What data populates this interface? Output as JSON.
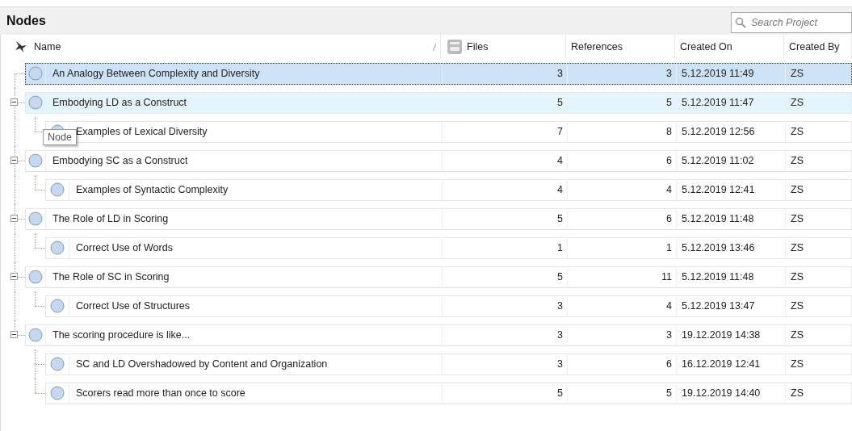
{
  "panel": {
    "title": "Nodes",
    "search": {
      "placeholder": "Search Project"
    }
  },
  "table": {
    "columns": [
      {
        "label": "Name",
        "sorted": true
      },
      {
        "label": "Files"
      },
      {
        "label": "References"
      },
      {
        "label": "Created On"
      },
      {
        "label": "Created By"
      }
    ],
    "rows": [
      {
        "name": "An Analogy Between Complexity and Diversity",
        "files": "3",
        "references": "3",
        "created_on": "5.12.2019 11:49",
        "created_by": "ZS",
        "selected": true,
        "hovered": false
      },
      {
        "name": "Embodying LD as a Construct",
        "files": "5",
        "references": "5",
        "created_on": "5.12.2019 11:47",
        "created_by": "ZS",
        "selected": false,
        "hovered": true,
        "expanded": true,
        "children": [
          {
            "name": "Examples of Lexical Diversity",
            "files": "7",
            "references": "8",
            "created_on": "5.12.2019 12:56",
            "created_by": "ZS",
            "selected": false,
            "hovered": false
          }
        ]
      },
      {
        "name": "Embodying SC as a Construct",
        "files": "4",
        "references": "6",
        "created_on": "5.12.2019 11:02",
        "created_by": "ZS",
        "selected": false,
        "hovered": false,
        "expanded": true,
        "children": [
          {
            "name": "Examples of Syntactic Complexity",
            "files": "4",
            "references": "4",
            "created_on": "5.12.2019 12:41",
            "created_by": "ZS",
            "selected": false,
            "hovered": false
          }
        ]
      },
      {
        "name": "The Role of LD in Scoring",
        "files": "5",
        "references": "6",
        "created_on": "5.12.2019 11:48",
        "created_by": "ZS",
        "selected": false,
        "hovered": false,
        "expanded": true,
        "children": [
          {
            "name": "Correct Use of Words",
            "files": "1",
            "references": "1",
            "created_on": "5.12.2019 13:46",
            "created_by": "ZS",
            "selected": false,
            "hovered": false
          }
        ]
      },
      {
        "name": "The Role of SC in Scoring",
        "files": "5",
        "references": "11",
        "created_on": "5.12.2019 11:48",
        "created_by": "ZS",
        "selected": false,
        "hovered": false,
        "expanded": true,
        "children": [
          {
            "name": "Correct Use of Structures",
            "files": "3",
            "references": "4",
            "created_on": "5.12.2019 13:47",
            "created_by": "ZS",
            "selected": false,
            "hovered": false
          }
        ]
      },
      {
        "name": "The scoring procedure is like...",
        "files": "3",
        "references": "3",
        "created_on": "19.12.2019 14:38",
        "created_by": "ZS",
        "selected": false,
        "hovered": false,
        "expanded": true,
        "children": [
          {
            "name": "SC and LD Overshadowed by Content and Organization",
            "files": "3",
            "references": "6",
            "created_on": "16.12.2019 12:41",
            "created_by": "ZS",
            "selected": false,
            "hovered": false
          },
          {
            "name": "Scorers read more than once to score",
            "files": "5",
            "references": "5",
            "created_on": "19.12.2019 14:40",
            "created_by": "ZS",
            "selected": false,
            "hovered": false
          }
        ]
      }
    ]
  },
  "tooltip": {
    "text": "Node"
  }
}
